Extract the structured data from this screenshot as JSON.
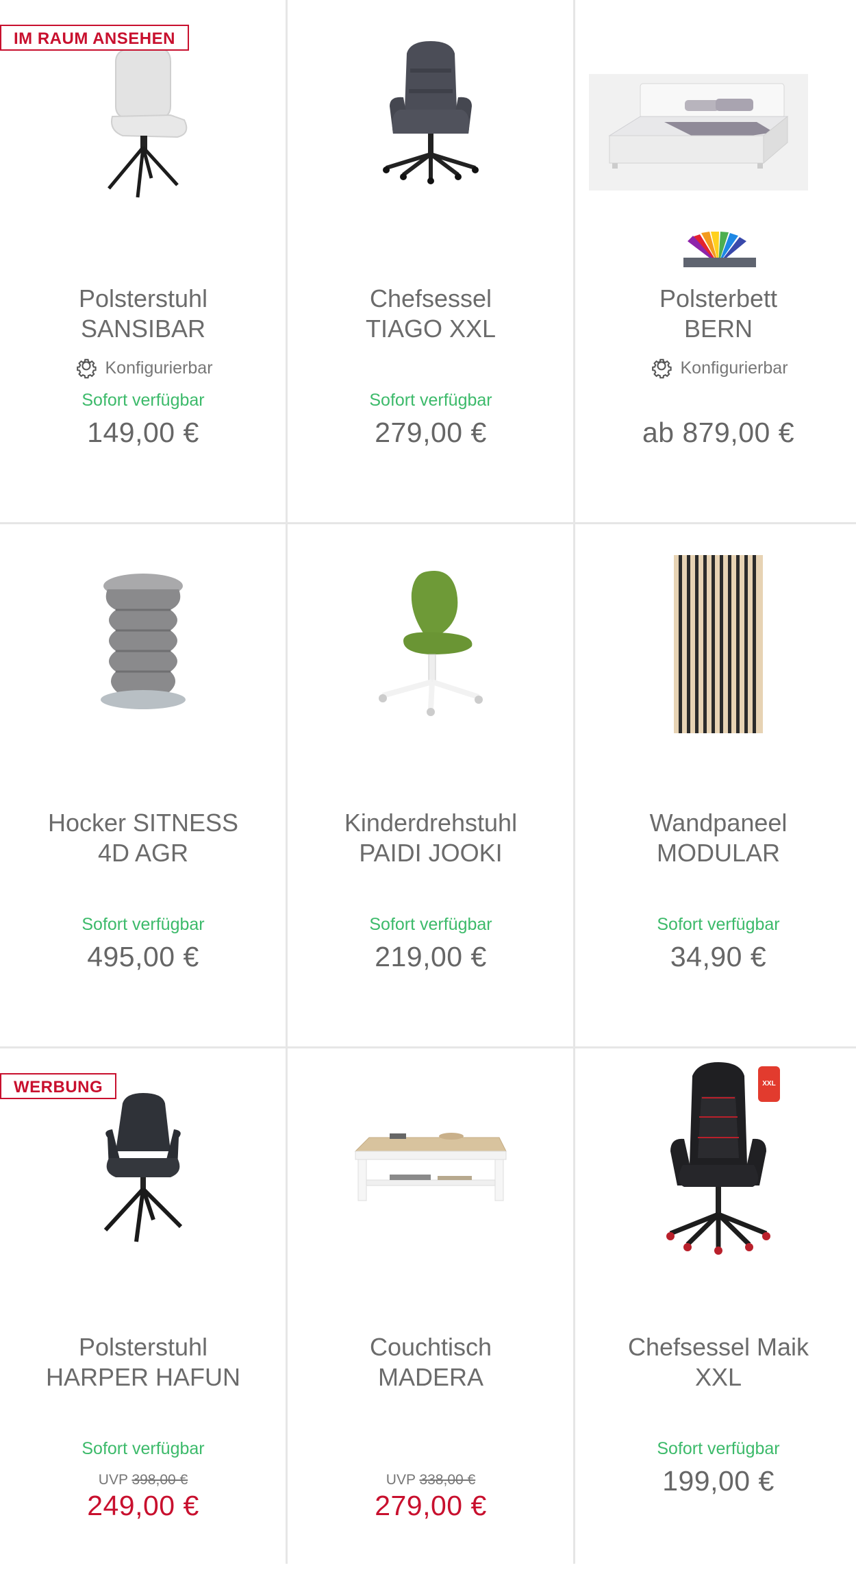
{
  "products": [
    {
      "badge": "IM RAUM ANSEHEN",
      "title_line1": "Polsterstuhl",
      "title_line2": "SANSIBAR",
      "config": "Konfigurierbar",
      "availability": "Sofort verfügbar",
      "price": "149,00 €"
    },
    {
      "title_line1": "Chefsessel",
      "title_line2": "TIAGO XXL",
      "availability": "Sofort verfügbar",
      "price": "279,00 €"
    },
    {
      "title_line1": "Polsterbett",
      "title_line2": "BERN",
      "config": "Konfigurierbar",
      "price": "ab 879,00 €"
    },
    {
      "title_line1": "Hocker SITNESS",
      "title_line2": "4D AGR",
      "availability": "Sofort verfügbar",
      "price": "495,00 €"
    },
    {
      "title_line1": "Kinderdrehstuhl",
      "title_line2": "PAIDI JOOKI",
      "availability": "Sofort verfügbar",
      "price": "219,00 €"
    },
    {
      "title_line1": "Wandpaneel",
      "title_line2": "MODULAR",
      "availability": "Sofort verfügbar",
      "price": "34,90 €"
    },
    {
      "badge": "WERBUNG",
      "title_line1": "Polsterstuhl",
      "title_line2": "HARPER HAFUN",
      "availability": "Sofort verfügbar",
      "uvp_label": "UVP",
      "uvp_price": "398,00 €",
      "price": "249,00 €"
    },
    {
      "title_line1": "Couchtisch",
      "title_line2": "MADERA",
      "uvp_label": "UVP",
      "uvp_price": "338,00 €",
      "price": "279,00 €"
    },
    {
      "title_line1": "Chefsessel Maik",
      "title_line2": "XXL",
      "availability": "Sofort verfügbar",
      "price": "199,00 €",
      "tag_text": "XXL"
    }
  ],
  "colors": {
    "accent": "#c8102e",
    "available": "#3cba6a",
    "text": "#666666",
    "divider": "#e6e6e6"
  }
}
